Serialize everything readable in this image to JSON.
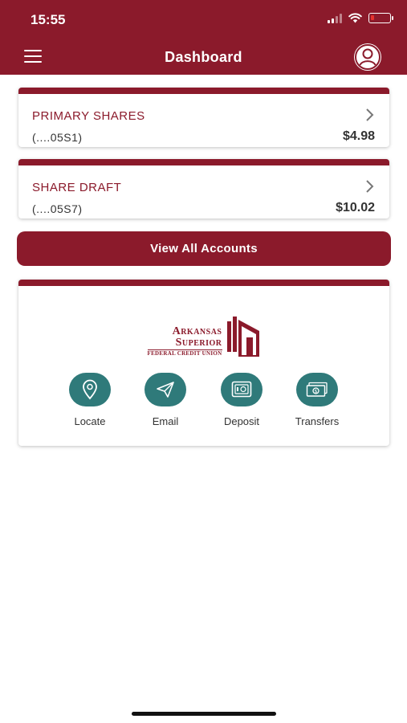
{
  "status_bar": {
    "time": "15:55"
  },
  "header": {
    "title": "Dashboard",
    "menu_icon": "hamburger-menu-icon",
    "profile_icon": "user-avatar-icon"
  },
  "accounts": [
    {
      "name": "PRIMARY SHARES",
      "number": "(....05S1)",
      "balance": "$4.98"
    },
    {
      "name": "SHARE DRAFT",
      "number": "(....05S7)",
      "balance": "$10.02"
    }
  ],
  "view_all_label": "View All Accounts",
  "brand": {
    "line1": "Arkansas",
    "line2": "Superior",
    "line3": "FEDERAL CREDIT UNION"
  },
  "actions": [
    {
      "label": "Locate",
      "icon": "location-pin-icon"
    },
    {
      "label": "Email",
      "icon": "paper-plane-icon"
    },
    {
      "label": "Deposit",
      "icon": "safe-icon"
    },
    {
      "label": "Transfers",
      "icon": "money-icon"
    }
  ],
  "colors": {
    "brand": "#8b1a2b",
    "action": "#2f7a7a",
    "battery_low": "#e5322d"
  }
}
